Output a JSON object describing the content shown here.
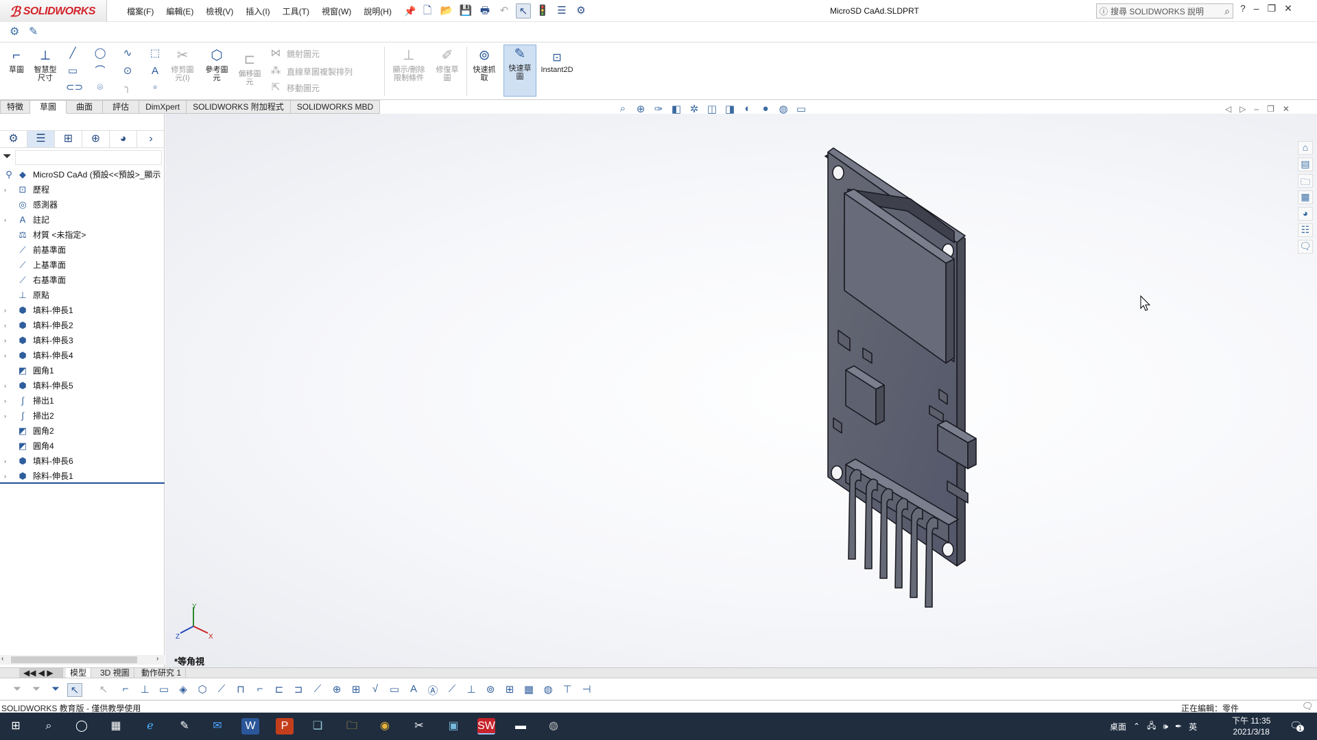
{
  "app": {
    "logo_text": "SOLIDWORKS",
    "document_title": "MicroSD CaAd.SLDPRT",
    "help_search_placeholder": "搜尋 SOLIDWORKS 說明"
  },
  "menu": [
    "檔案(F)",
    "編輯(E)",
    "檢視(V)",
    "插入(I)",
    "工具(T)",
    "視窗(W)",
    "說明(H)"
  ],
  "ribbon": {
    "sketch": "草圖",
    "smart_dim_1": "智慧型",
    "smart_dim_2": "尺寸",
    "trim_1": "修剪圖",
    "trim_2": "元(I)",
    "convert_1": "參考圖",
    "convert_2": "元",
    "offset_1": "偏移圖",
    "offset_2": "元",
    "mirror": "鏡射圖元",
    "linear_pattern": "直線草圖複製排列",
    "move": "移動圖元",
    "show_rel_1": "顯示/刪除",
    "show_rel_2": "限制條件",
    "repair_1": "修復草",
    "repair_2": "圖",
    "snap_1": "快速抓",
    "snap_2": "取",
    "rapid_1": "快速草",
    "rapid_2": "圖",
    "instant2d": "Instant2D"
  },
  "tabs": [
    "特徵",
    "草圖",
    "曲面",
    "評估",
    "DimXpert",
    "SOLIDWORKS 附加程式",
    "SOLIDWORKS MBD"
  ],
  "tree": {
    "root": "MicroSD CaAd (預設<<預設>_顯示",
    "items": [
      {
        "label": "歷程",
        "expand": true
      },
      {
        "label": "感測器",
        "expand": false
      },
      {
        "label": "註記",
        "expand": true
      },
      {
        "label": "材質 <未指定>",
        "expand": false
      },
      {
        "label": "前基準面",
        "expand": false
      },
      {
        "label": "上基準面",
        "expand": false
      },
      {
        "label": "右基準面",
        "expand": false
      },
      {
        "label": "原點",
        "expand": false
      },
      {
        "label": "填料-伸長1",
        "expand": true
      },
      {
        "label": "填料-伸長2",
        "expand": true
      },
      {
        "label": "填料-伸長3",
        "expand": true
      },
      {
        "label": "填料-伸長4",
        "expand": true
      },
      {
        "label": "圓角1",
        "expand": false
      },
      {
        "label": "填料-伸長5",
        "expand": true
      },
      {
        "label": "掃出1",
        "expand": true
      },
      {
        "label": "掃出2",
        "expand": true
      },
      {
        "label": "圓角2",
        "expand": false
      },
      {
        "label": "圓角4",
        "expand": false
      },
      {
        "label": "填料-伸長6",
        "expand": true
      },
      {
        "label": "除料-伸長1",
        "expand": true
      }
    ]
  },
  "viewport": {
    "view_label": "*等角視",
    "axis_x": "X",
    "axis_y": "Y",
    "axis_z": "Z"
  },
  "bottom_tabs": [
    "模型",
    "3D 視圖",
    "動作研究 1"
  ],
  "status": {
    "left": "SOLIDWORKS 教育版 - 僅供教學使用",
    "right": "正在編輯：零件"
  },
  "taskbar": {
    "desktop": "桌面",
    "ime": "英",
    "time": "下午 11:35",
    "date": "2021/3/18",
    "notifications": "1"
  },
  "colors": {
    "accent": "#d2232a",
    "taskbar": "#1f2d3f",
    "model": "#5c5f6b"
  }
}
